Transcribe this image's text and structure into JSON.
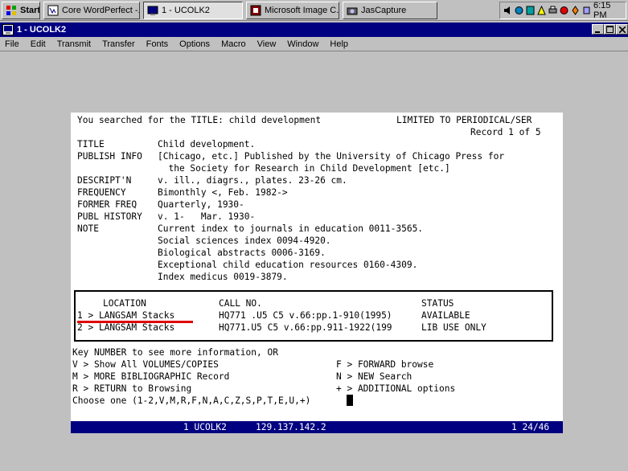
{
  "taskbar": {
    "start_label": "Start",
    "tasks": [
      {
        "label": "Core WordPerfect -...",
        "active": false
      },
      {
        "label": "1 - UCOLK2",
        "active": true
      },
      {
        "label": "Microsoft Image C...",
        "active": false
      },
      {
        "label": "JasCapture",
        "active": false
      }
    ],
    "clock": "6:15 PM"
  },
  "window": {
    "title": "1 - UCOLK2",
    "menu": [
      "File",
      "Edit",
      "Transmit",
      "Transfer",
      "Fonts",
      "Options",
      "Macro",
      "View",
      "Window",
      "Help"
    ]
  },
  "terminal": {
    "search_line": "You searched for the TITLE: child development",
    "limited": "LIMITED TO PERIODICAL/SER",
    "record_counter": "Record 1 of 5",
    "fields": [
      {
        "label": "TITLE",
        "value": "Child development."
      },
      {
        "label": "PUBLISH INFO",
        "value": "[Chicago, etc.] Published by the University of Chicago Press for"
      },
      {
        "label": "",
        "value": "  the Society for Research in Child Development [etc.]"
      },
      {
        "label": "DESCRIPT'N",
        "value": "v. ill., diagrs., plates. 23-26 cm."
      },
      {
        "label": "FREQUENCY",
        "value": "Bimonthly <, Feb. 1982->"
      },
      {
        "label": "FORMER FREQ",
        "value": "Quarterly, 1930-"
      },
      {
        "label": "PUBL HISTORY",
        "value": "v. 1-   Mar. 1930-"
      },
      {
        "label": "NOTE",
        "value": "Current index to journals in education 0011-3565."
      },
      {
        "label": "",
        "value": "Social sciences index 0094-4920."
      },
      {
        "label": "",
        "value": "Biological abstracts 0006-3169."
      },
      {
        "label": "",
        "value": "Exceptional child education resources 0160-4309."
      },
      {
        "label": "",
        "value": "Index medicus 0019-3879."
      }
    ],
    "holdings": {
      "headers": {
        "location": "LOCATION",
        "call_no": "CALL NO.",
        "status": "STATUS"
      },
      "rows": [
        {
          "location": "1 > LANGSAM Stacks",
          "call_no": "HQ771 .U5 C5 v.66:pp.1-910(1995)",
          "status": "AVAILABLE"
        },
        {
          "location": "2 > LANGSAM Stacks",
          "call_no": "HQ771.U5 C5 v.66:pp.911-1922(199",
          "status": "LIB USE ONLY"
        }
      ]
    },
    "prompt_header": "Key NUMBER to see more information, OR",
    "options": [
      {
        "left": "V > Show All VOLUMES/COPIES",
        "right": "F > FORWARD browse"
      },
      {
        "left": "M > MORE BIBLIOGRAPHIC Record",
        "right": "N > NEW Search"
      },
      {
        "left": "R > RETURN to Browsing",
        "right": "+ > ADDITIONAL options"
      }
    ],
    "choose_line": "Choose one (1-2,V,M,R,F,N,A,C,Z,S,P,T,E,U,+)",
    "status_bar": {
      "session": "1 UCOLK2",
      "address": "129.137.142.2",
      "position": "1 24/46"
    }
  }
}
